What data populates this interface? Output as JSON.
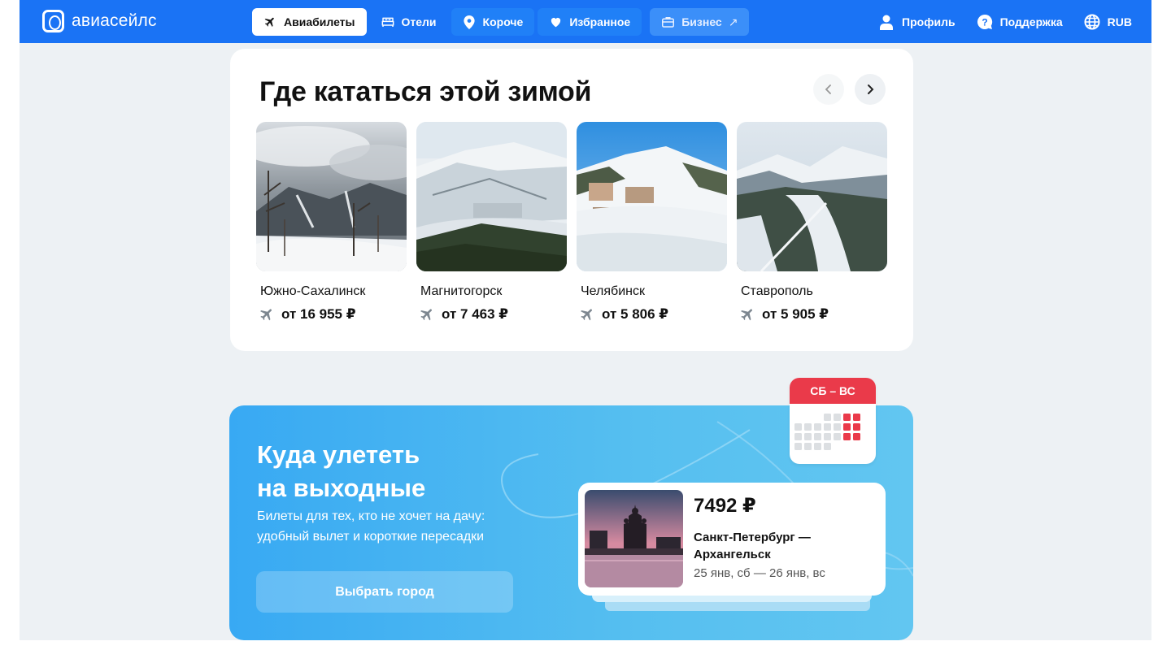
{
  "header": {
    "logo_text": "авиасейлс",
    "nav": [
      {
        "label": "Авиабилеты",
        "icon": "plane-icon",
        "active": true
      },
      {
        "label": "Отели",
        "icon": "bed-icon"
      },
      {
        "label": "Короче",
        "icon": "location-pin-icon"
      },
      {
        "label": "Избранное",
        "icon": "heart-icon"
      },
      {
        "label": "Бизнес",
        "icon": "briefcase-icon",
        "external_icon": "↗"
      }
    ],
    "right": {
      "profile": "Профиль",
      "support": "Поддержка",
      "currency": "RUB"
    }
  },
  "winter": {
    "title": "Где кататься этой зимой",
    "cities": [
      {
        "name": "Южно-Сахалинск",
        "price": "от 16 955 ₽"
      },
      {
        "name": "Магнитогорск",
        "price": "от 7 463 ₽"
      },
      {
        "name": "Челябинск",
        "price": "от 5 806 ₽"
      },
      {
        "name": "Ставрополь",
        "price": "от 5 905 ₽"
      }
    ]
  },
  "weekend": {
    "title_line1": "Куда улететь",
    "title_line2": "на выходные",
    "subtitle_line1": "Билеты для тех, кто не хочет на дачу:",
    "subtitle_line2": "удобный вылет и короткие пересадки",
    "button": "Выбрать город",
    "calendar_label": "СБ – ВС",
    "ticket": {
      "price": "7492 ₽",
      "route_line1": "Санкт-Петербург —",
      "route_line2": "Архангельск",
      "dates": "25 янв, сб — 26 янв, вс"
    }
  },
  "colors": {
    "brand_blue": "#1a73f5",
    "calendar_red": "#ea3a4a",
    "page_bg": "#edf1f4"
  }
}
